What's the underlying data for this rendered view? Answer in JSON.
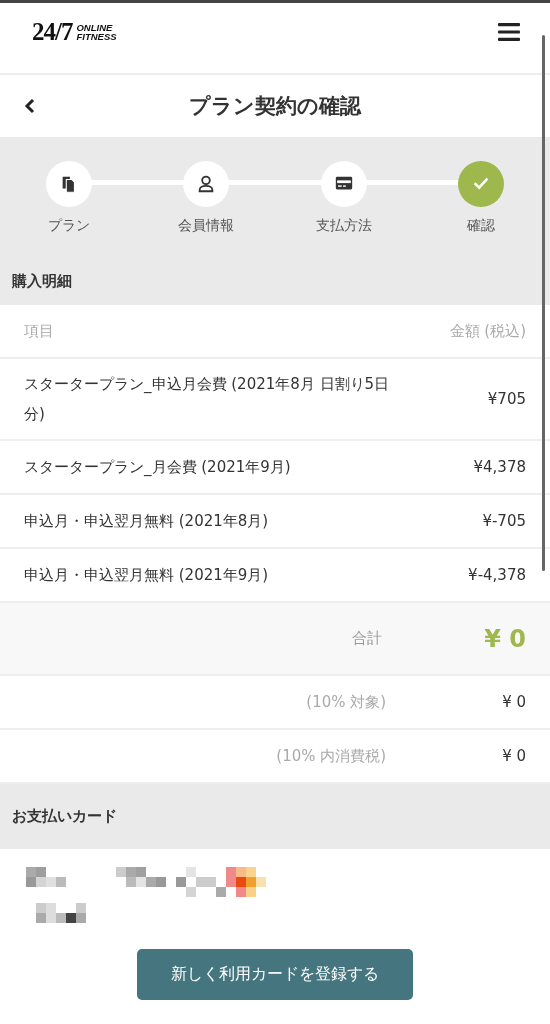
{
  "header": {
    "logo_number": "24/7",
    "logo_words": [
      "ONLINE",
      "FITNESS"
    ]
  },
  "title_bar": {
    "title": "プラン契約の確認"
  },
  "steps": [
    {
      "label": "プラン",
      "selected": false
    },
    {
      "label": "会員情報",
      "selected": false
    },
    {
      "label": "支払方法",
      "selected": false
    },
    {
      "label": "確認",
      "selected": true
    }
  ],
  "purchase": {
    "heading": "購入明細",
    "columns": [
      "項目",
      "金額 (税込)"
    ],
    "rows": [
      {
        "item": "スタータープラン_申込月会費 (2021年8月 日割り5日分)",
        "amount": "¥705"
      },
      {
        "item": "スタータープラン_月会費 (2021年9月)",
        "amount": "¥4,378"
      },
      {
        "item": "申込月・申込翌月無料 (2021年8月)",
        "amount": "¥-705"
      },
      {
        "item": "申込月・申込翌月無料 (2021年9月)",
        "amount": "¥-4,378"
      }
    ],
    "total": {
      "label": "合計",
      "amount": "¥ 0"
    },
    "tax_rows": [
      {
        "label": "(10% 対象)",
        "amount": "¥ 0"
      },
      {
        "label": "(10% 内消費税)",
        "amount": "¥ 0"
      }
    ]
  },
  "card": {
    "heading": "お支払いカード",
    "button": "新しく利用カードを登録する"
  }
}
